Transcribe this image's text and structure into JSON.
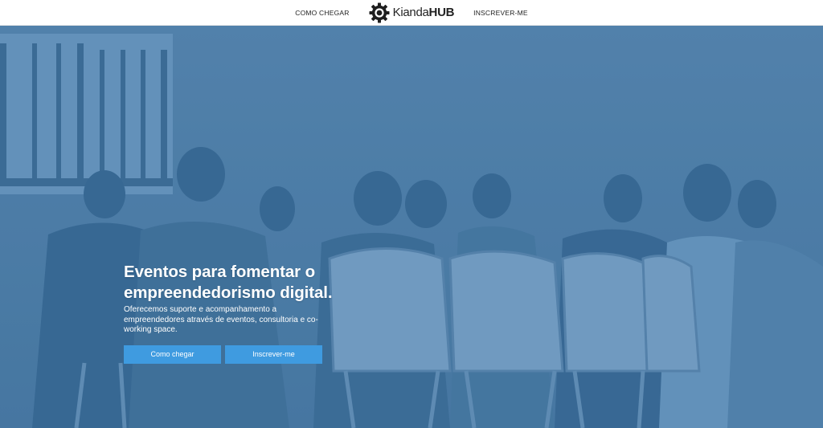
{
  "nav": {
    "left_link": "COMO CHEGAR",
    "right_link": "INSCREVER-ME",
    "logo": {
      "text_regular": "Kianda",
      "text_bold": "HUB",
      "icon": "gear-logo-icon"
    }
  },
  "hero": {
    "background_image": "audience-at-event-photo",
    "overlay_color": "#4f7ea8",
    "title": "Eventos para fomentar o empreendedorismo digital.",
    "description": "Oferecemos suporte e acompanhamento a empreendedores através de eventos, consultoria e co-working space.",
    "primary_button": "Como chegar",
    "secondary_button": "Inscrever-me",
    "button_color": "#3f9be0"
  }
}
